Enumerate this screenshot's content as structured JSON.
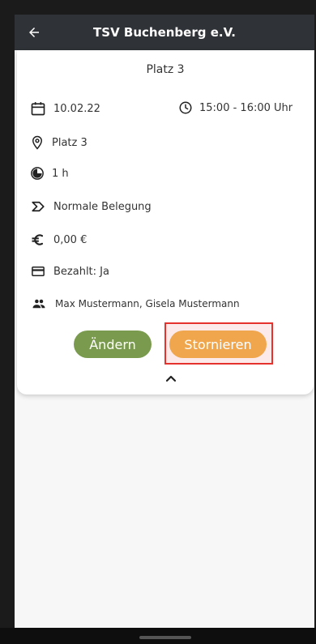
{
  "header": {
    "title": "TSV Buchenberg e.V.",
    "back_icon": "arrow-left-icon"
  },
  "booking": {
    "court": "Platz 3",
    "date": "10.02.22",
    "time": "15:00 - 16:00 Uhr",
    "location": "Platz 3",
    "duration": "1 h",
    "type": "Normale Belegung",
    "price": "0,00 €",
    "paid": "Bezahlt: Ja",
    "participants": "Max Mustermann, Gisela Mustermann"
  },
  "actions": {
    "change_label": "Ändern",
    "cancel_label": "Stornieren"
  },
  "colors": {
    "app_bar": "#2f3236",
    "change_button": "#7a9b4e",
    "cancel_button": "#f0a64c",
    "highlight": "#e5322d"
  }
}
